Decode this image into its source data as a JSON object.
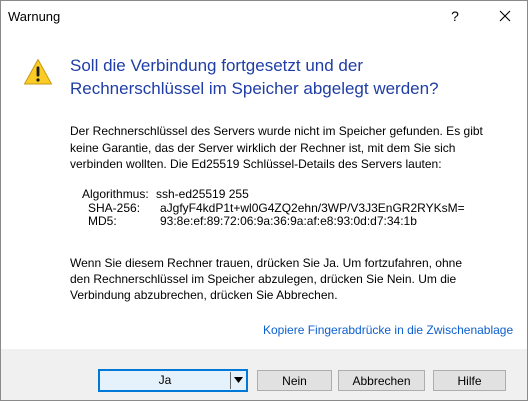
{
  "window": {
    "title": "Warnung",
    "help_glyph": "?",
    "close_icon": "close-icon",
    "accent_color": "#1f3da6",
    "link_color": "#0b5fd0"
  },
  "dialog": {
    "icon": "warning-triangle-icon",
    "headline_line1": "Soll die Verbindung fortgesetzt und der",
    "headline_line2": "Rechnerschlüssel im Speicher abgelegt werden?",
    "para1_line1": "Der Rechnerschlüssel des Servers wurde nicht im Speicher gefunden. Es gibt",
    "para1_line2": "keine Garantie, das der Server wirklich der Rechner ist, mit dem Sie sich",
    "para1_line3": "verbinden wollten. Die Ed25519 Schlüssel-Details des Servers lauten:",
    "key_details": [
      {
        "label": "Algorithmus:",
        "value": "ssh-ed25519 255"
      },
      {
        "label": "SHA-256:",
        "value": "aJgfyF4kdP1t+wl0G4ZQ2ehn/3WP/V3J3EnGR2RYKsM="
      },
      {
        "label": "MD5:",
        "value": "93:8e:ef:89:72:06:9a:36:9a:af:e8:93:0d:d7:34:1b"
      }
    ],
    "para2_line1": "Wenn Sie diesem Rechner trauen, drücken Sie Ja. Um fortzufahren, ohne",
    "para2_line2": "den Rechnerschlüssel im Speicher abzulegen, drücken Sie Nein. Um die",
    "para2_line3": "Verbindung abzubrechen, drücken Sie Abbrechen.",
    "copy_link": "Kopiere Fingerabdrücke in die Zwischenablage"
  },
  "buttons": {
    "ja": "Ja",
    "nein": "Nein",
    "abbrechen": "Abbrechen",
    "hilfe": "Hilfe"
  }
}
